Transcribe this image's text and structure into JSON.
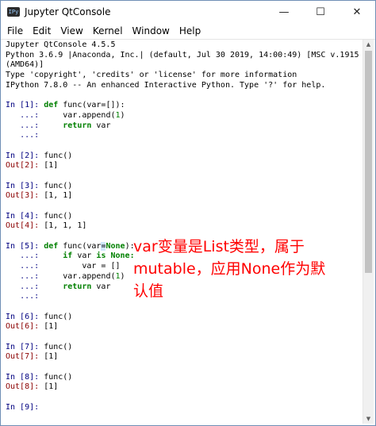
{
  "window": {
    "title": "Jupyter QtConsole",
    "controls": {
      "minimize": "—",
      "maximize": "☐",
      "close": "✕"
    }
  },
  "menu": [
    "File",
    "Edit",
    "View",
    "Kernel",
    "Window",
    "Help"
  ],
  "banner": [
    "Jupyter QtConsole 4.5.5",
    "Python 3.6.9 |Anaconda, Inc.| (default, Jul 30 2019, 14:00:49) [MSC v.1915 64 bit",
    "(AMD64)]",
    "Type 'copyright', 'credits' or 'license' for more information",
    "IPython 7.8.0 -- An enhanced Interactive Python. Type '?' for help."
  ],
  "cells": {
    "c1": {
      "prompt": "In [1]:",
      "cont": "...:"
    },
    "c2": {
      "prompt": "In [2]:",
      "code": "func()",
      "out_prompt": "Out[2]:",
      "out": "[1]"
    },
    "c3": {
      "prompt": "In [3]:",
      "code": "func()",
      "out_prompt": "Out[3]:",
      "out": "[1, 1]"
    },
    "c4": {
      "prompt": "In [4]:",
      "code": "func()",
      "out_prompt": "Out[4]:",
      "out": "[1, 1, 1]"
    },
    "c5": {
      "prompt": "In [5]:",
      "cont": "...:"
    },
    "c6": {
      "prompt": "In [6]:",
      "code": "func()",
      "out_prompt": "Out[6]:",
      "out": "[1]"
    },
    "c7": {
      "prompt": "In [7]:",
      "code": "func()",
      "out_prompt": "Out[7]:",
      "out": "[1]"
    },
    "c8": {
      "prompt": "In [8]:",
      "code": "func()",
      "out_prompt": "Out[8]:",
      "out": "[1]"
    },
    "c9": {
      "prompt": "In [9]:"
    }
  },
  "code": {
    "def": "def",
    "func_sig_a": " func(var=[]):",
    "func_sig_b_pre": " func(var",
    "func_sig_b_eq": "=",
    "func_sig_b_none": "None",
    "func_sig_b_post": "):",
    "append": "var.append(",
    "one": "1",
    "close_paren": ")",
    "return": "return",
    "var": " var",
    "if": "if",
    "var_sp": " var ",
    "is": "is",
    "none_colon": " None:",
    "assign": "var = []"
  },
  "annotation": {
    "line1": "var变量是List类型，属于",
    "line2": "mutable，应用None作为默",
    "line3": "认值"
  },
  "colors": {
    "prompt_in": "#000080",
    "prompt_out": "#8b0000",
    "keyword": "#008000",
    "annotation": "#ff0000"
  }
}
